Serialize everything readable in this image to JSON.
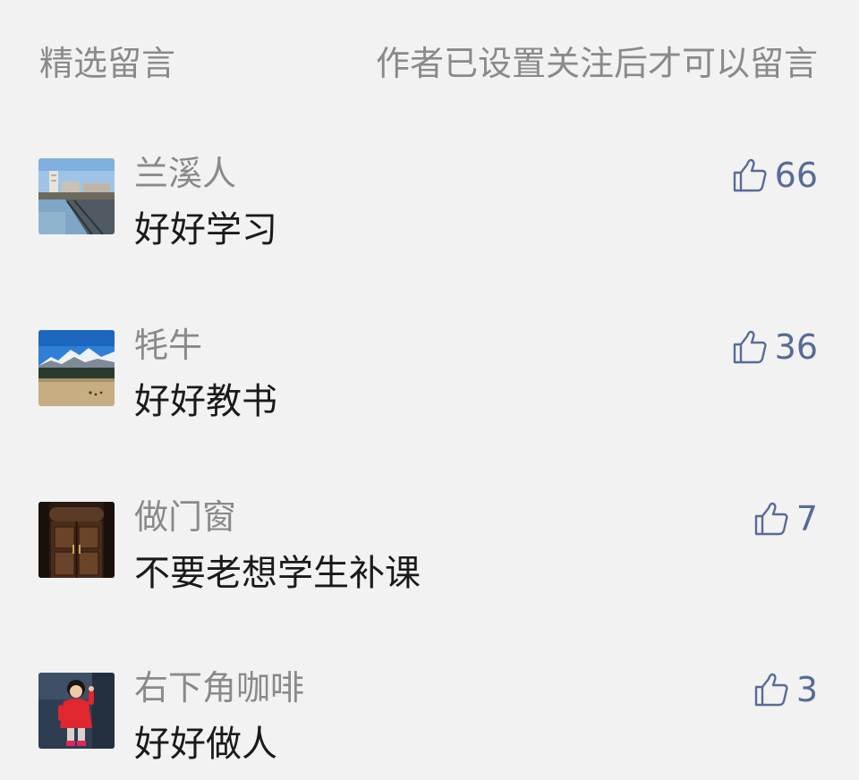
{
  "header": {
    "title": "精选留言",
    "note": "作者已设置关注后才可以留言"
  },
  "comments": [
    {
      "nickname": "兰溪人",
      "content": "好好学习",
      "likes": "66",
      "avatar": "harbor-photo"
    },
    {
      "nickname": "牦牛",
      "content": "好好教书",
      "likes": "36",
      "avatar": "snow-mountain-photo"
    },
    {
      "nickname": "做门窗",
      "content": "不要老想学生补课",
      "likes": "7",
      "avatar": "wooden-door-photo"
    },
    {
      "nickname": "右下角咖啡",
      "content": "好好做人",
      "likes": "3",
      "avatar": "child-in-red-photo"
    }
  ],
  "colors": {
    "background": "#f2f2f2",
    "secondary_text": "#8a8a8a",
    "primary_text": "#1a1a1a",
    "link_blue": "#576b95"
  },
  "icons": {
    "like": "thumbs-up-icon"
  }
}
